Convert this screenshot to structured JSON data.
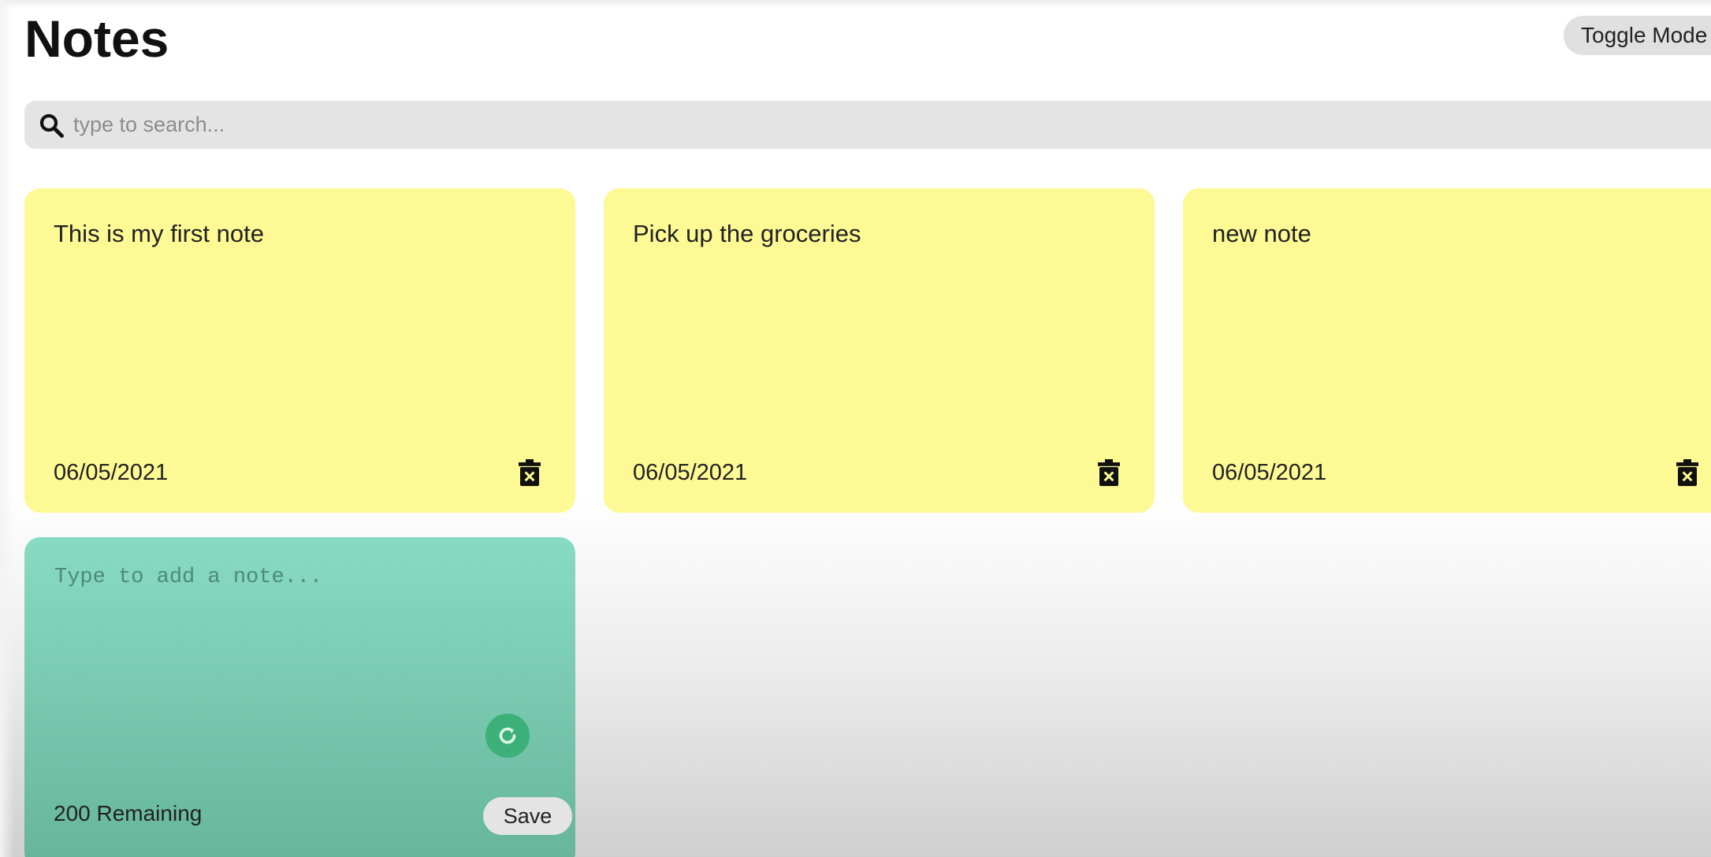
{
  "header": {
    "title": "Notes",
    "toggle_label": "Toggle Mode"
  },
  "search": {
    "placeholder": "type to search...",
    "icon": "search-icon"
  },
  "notes": [
    {
      "text": "This is my first note",
      "date": "06/05/2021"
    },
    {
      "text": "Pick up the groceries",
      "date": "06/05/2021"
    },
    {
      "text": "new note",
      "date": "06/05/2021"
    }
  ],
  "new_note": {
    "placeholder": "Type to add a note...",
    "remaining_label": "200 Remaining",
    "save_label": "Save"
  },
  "colors": {
    "note_bg": "#fdf994",
    "new_note_bg": "#88dbc1",
    "refresh_icon": "#3cb078",
    "search_bg": "#e4e4e4"
  },
  "icons": {
    "delete": "trash-icon",
    "refresh": "refresh-icon"
  }
}
